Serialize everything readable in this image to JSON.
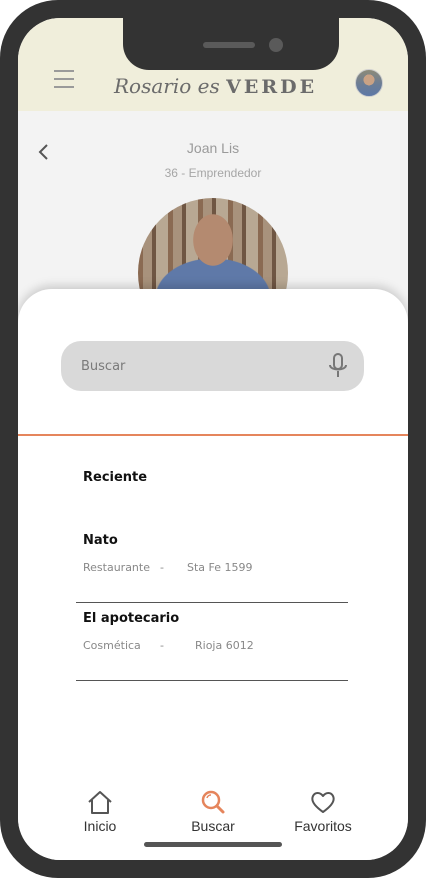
{
  "header": {
    "logo_script": "Rosario es",
    "logo_bold": "VERDE"
  },
  "profile": {
    "name": "Joan Lis",
    "subtitle": "36 - Emprendedor"
  },
  "search": {
    "placeholder": "Buscar"
  },
  "recent": {
    "title": "Reciente",
    "items": [
      {
        "name": "Nato",
        "category": "Restaurante",
        "separator": "-",
        "address": "Sta Fe 1599"
      },
      {
        "name": "El apotecario",
        "category": "Cosmética",
        "separator": "-",
        "address": "Rioja 6012"
      }
    ]
  },
  "nav": {
    "items": [
      {
        "label": "Inicio",
        "icon": "home-icon"
      },
      {
        "label": "Buscar",
        "icon": "search-icon"
      },
      {
        "label": "Favoritos",
        "icon": "heart-icon"
      }
    ],
    "active": "Buscar"
  },
  "colors": {
    "accent": "#e5855c",
    "header_bg": "#f0eedb",
    "frame": "#333333"
  }
}
